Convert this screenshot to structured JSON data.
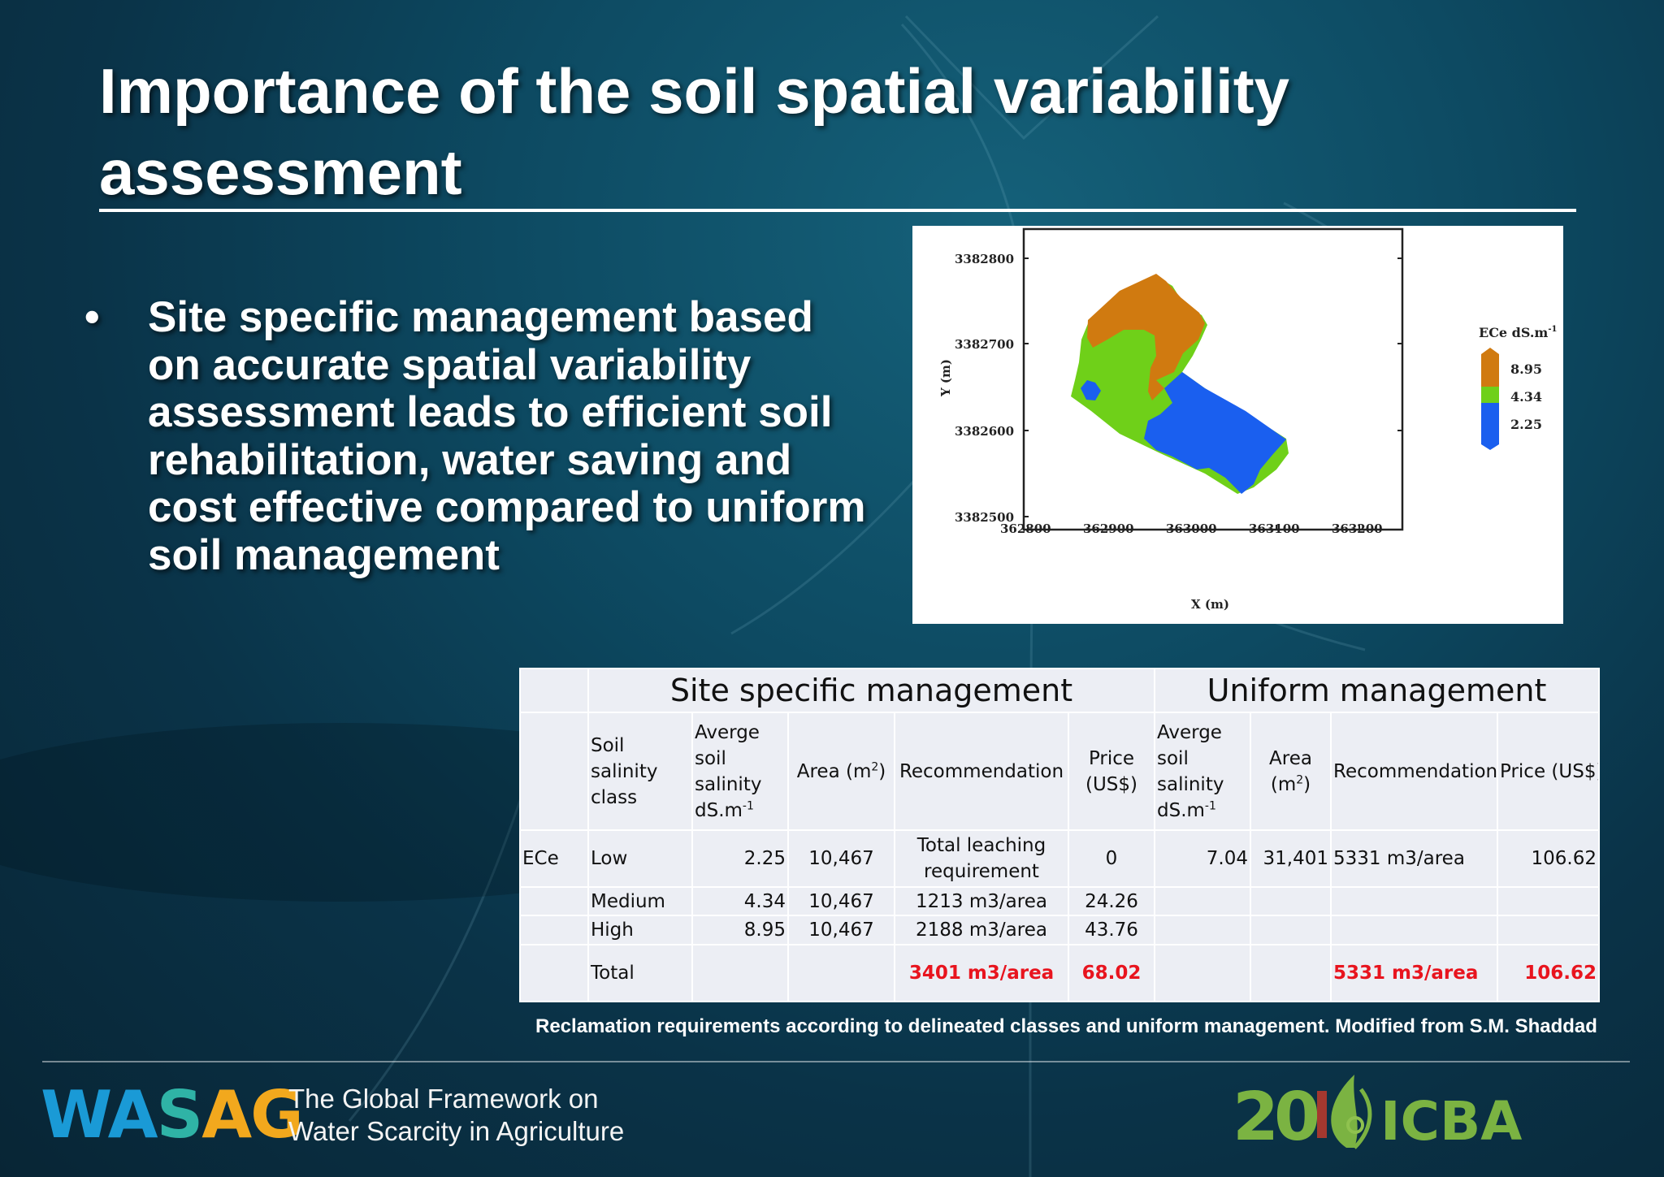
{
  "slide": {
    "title": "Importance of the soil spatial variability assessment",
    "bullet_symbol": "•",
    "bullet_text": "Site specific management based on accurate spatial variability assessment leads to efficient soil rehabilitation, water saving and cost effective compared to uniform soil management",
    "caption": "Reclamation requirements according to delineated classes and uniform management. Modified from S.M. Shaddad"
  },
  "map": {
    "y_axis_label": "Y (m)",
    "x_axis_label": "X (m)",
    "y_ticks": [
      "3382800",
      "3382700",
      "3382600",
      "3382500"
    ],
    "x_ticks": [
      "362800",
      "362900",
      "363000",
      "363100",
      "363200"
    ],
    "legend_title": "ECe dS.m",
    "legend_title_sup": "-1",
    "legend_values": [
      "8.95",
      "4.34",
      "2.25"
    ],
    "colors": {
      "high": "#d07a10",
      "medium": "#6fd019",
      "low": "#1a5fef"
    }
  },
  "table": {
    "group_site": "Site specific management",
    "group_uniform": "Uniform management",
    "col_class": "Soil salinity class",
    "col_avg": "Averge soil salinity dS.m",
    "col_avg_sup": "-1",
    "col_area": "Area (m",
    "col_area_sup": "2",
    "col_area_end": ")",
    "col_rec": "Recommendation",
    "col_price": "Price (US$)",
    "col_price_uniform": "Price (US$)",
    "param": "ECe",
    "rows": [
      {
        "class": "Low",
        "avg": "2.25",
        "area": "10,467",
        "rec": "Total leaching requirement",
        "price": "0",
        "u_avg": "7.04",
        "u_area": "31,401",
        "u_rec": "5331 m3/area",
        "u_price": "106.62"
      },
      {
        "class": "Medium",
        "avg": "4.34",
        "area": "10,467",
        "rec": "1213 m3/area",
        "price": "24.26"
      },
      {
        "class": "High",
        "avg": "8.95",
        "area": "10,467",
        "rec": "2188 m3/area",
        "price": "43.76"
      }
    ],
    "total": {
      "label": "Total",
      "rec": "3401 m3/area",
      "price": "68.02",
      "u_rec": "5331 m3/area",
      "u_price": "106.62"
    }
  },
  "footer": {
    "wasag_wa": "WA",
    "wasag_s": "S",
    "wasag_ag": "AG",
    "tagline_1": "The Global Framework on",
    "tagline_2": "Water Scarcity in Agriculture",
    "icba_number": "20",
    "icba_name": "ICBA"
  }
}
